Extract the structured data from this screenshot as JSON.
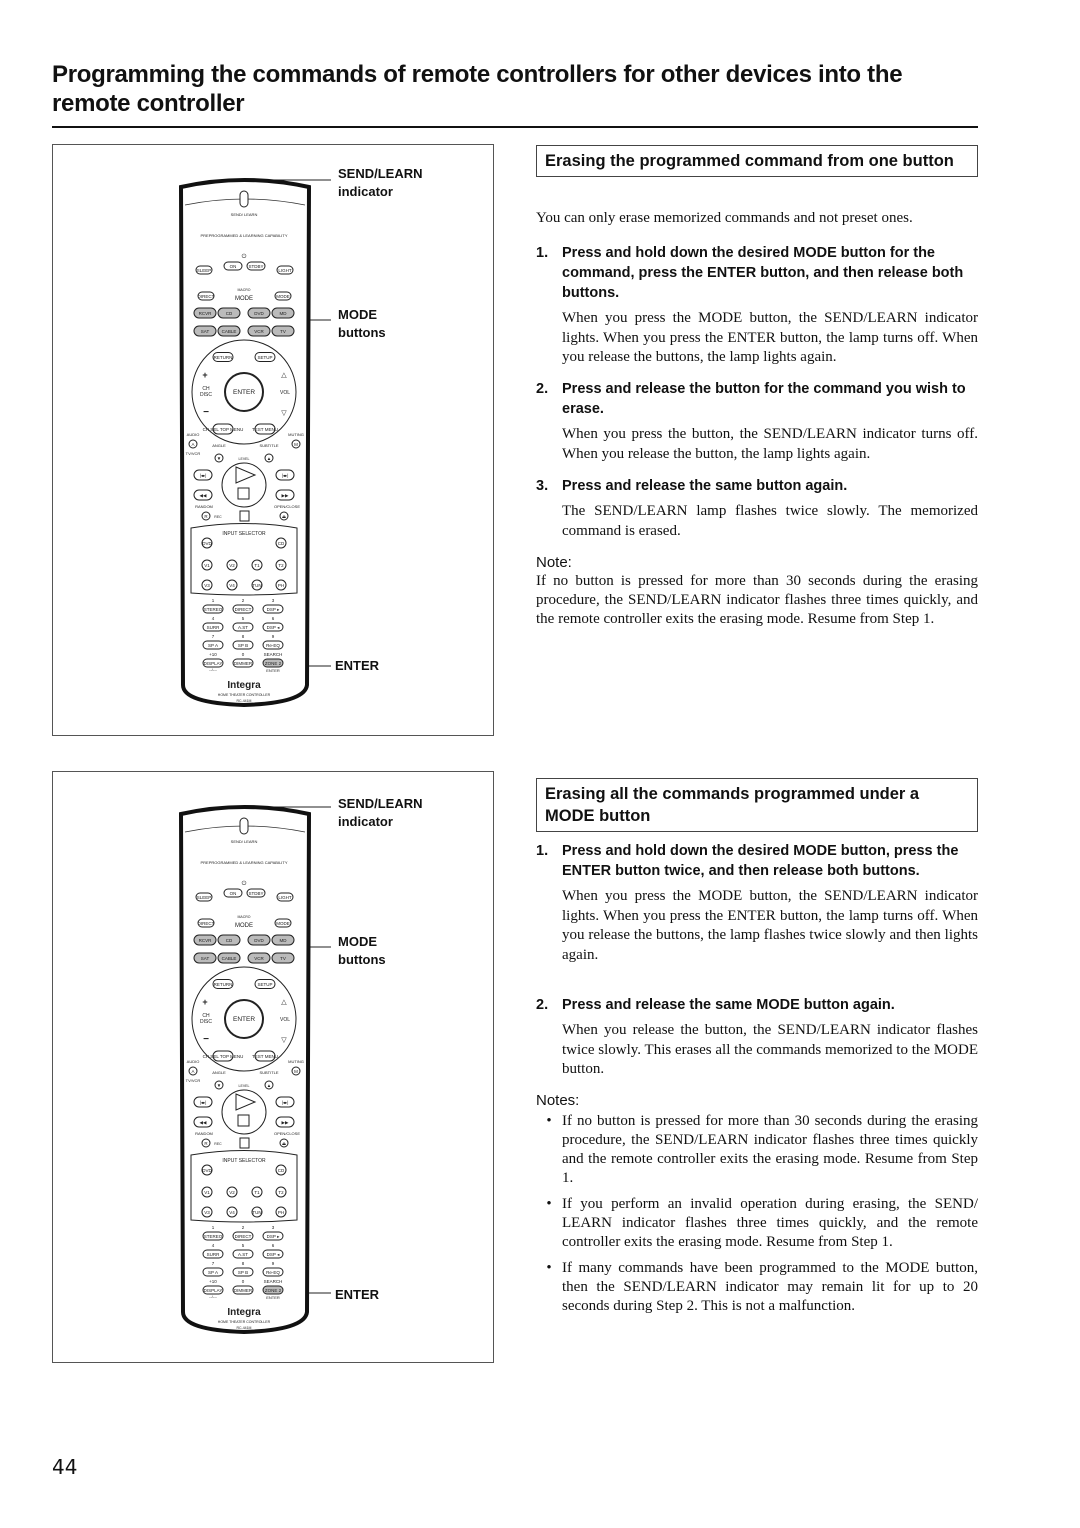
{
  "page": {
    "title": "Programming the commands of remote controllers for other devices into the remote controller",
    "page_number": "44"
  },
  "figures": [
    {
      "callouts": {
        "send_learn": "SEND/LEARN",
        "send_learn_sub": "indicator",
        "mode": "MODE",
        "mode_sub": "buttons",
        "enter": "ENTER"
      }
    },
    {
      "callouts": {
        "send_learn": "SEND/LEARN",
        "send_learn_sub": "indicator",
        "mode": "MODE",
        "mode_sub": "buttons",
        "enter": "ENTER"
      }
    }
  ],
  "remote": {
    "indicator_label": "SEND/ LEARN",
    "capability_text": "PREPROGRAMMED & LEARNING CAPABILITY",
    "power_icon": "power-icon",
    "top_buttons": [
      "SLEEP",
      "ON",
      "STDBY",
      "LIGHT"
    ],
    "macro_label": "MACRO",
    "direct_label": "DIRECT",
    "mode_btn_label": "MODE",
    "mode_group_label": "MODE",
    "mode_row1": [
      "RCVR",
      "CD",
      "DVD",
      "MD"
    ],
    "mode_row2": [
      "SAT",
      "CABLE",
      "VCR",
      "TV"
    ],
    "nav": {
      "return": "RETURN",
      "setup": "SETUP",
      "ch_disc": "CH DISC",
      "enter": "ENTER",
      "vol": "VOL",
      "top_menu": "CH SEL TOP MENU",
      "menu": "TEST MENU"
    },
    "audio_label": "AUDIO",
    "muting_label": "MUTING",
    "tvvcr_label": "TV/VCR",
    "angle_label": "ANGLE",
    "subtitle_label": "SUBTITLE",
    "level_label": "LEVEL",
    "random_label": "RANDOM",
    "rec_label": "REC",
    "open_close_label": "OPEN/CLOSE",
    "input_selector_label": "INPUT SELECTOR",
    "input_row1": [
      "DVD",
      "CD"
    ],
    "input_row2": [
      "V1",
      "V2",
      "T1",
      "T2"
    ],
    "input_row3": [
      "V3",
      "V4",
      "TUN",
      "PH"
    ],
    "keypad": [
      {
        "num": "1",
        "label": "STEREO"
      },
      {
        "num": "2",
        "label": "DIRECT"
      },
      {
        "num": "3",
        "label": "DSP ▸"
      },
      {
        "num": "4",
        "label": "SURR"
      },
      {
        "num": "5",
        "label": "A.ST"
      },
      {
        "num": "6",
        "label": "DSP ◂"
      },
      {
        "num": "7",
        "label": "SP A"
      },
      {
        "num": "8",
        "label": "SP B"
      },
      {
        "num": "9",
        "label": "Re-EQ"
      },
      {
        "num": "+10",
        "label": "DISPLAY"
      },
      {
        "num": "0",
        "label": "DIMMER"
      },
      {
        "num": "SEARCH",
        "label": "ZONE 2"
      }
    ],
    "dash_label": "--/---",
    "enter_small": "ENTER",
    "brand": "Integra",
    "model_line1": "HOME THEATER CONTROLLER",
    "model_line2": "RC-441M"
  },
  "section1": {
    "heading": "Erasing the programmed command from one button",
    "intro": "You can only erase memorized commands and not preset ones.",
    "steps": [
      {
        "num": "1.",
        "title": "Press and hold down the desired MODE button for the command, press the ENTER button, and then release both buttons.",
        "body": "When you press the MODE button, the SEND/LEARN indicator lights. When you press the ENTER button, the lamp turns off. When you release the buttons, the lamp lights again."
      },
      {
        "num": "2.",
        "title": "Press and release the button for the command you wish to erase.",
        "body": "When you press the button, the SEND/LEARN indicator turns off. When you release the button, the lamp lights again."
      },
      {
        "num": "3.",
        "title": "Press and release the same button again.",
        "body": "The SEND/LEARN lamp flashes twice slowly. The memorized command is erased."
      }
    ],
    "note_label": "Note:",
    "note": "If no button is pressed for more than 30 seconds during the erasing procedure, the SEND/LEARN indicator flashes three times quickly, and the remote controller exits the erasing mode. Resume from Step 1."
  },
  "section2": {
    "heading": "Erasing all the commands programmed under a MODE button",
    "steps": [
      {
        "num": "1.",
        "title": "Press and hold down the desired MODE button, press the ENTER button twice, and then release both buttons.",
        "body": "When you press the MODE button, the SEND/LEARN indicator lights. When you press the ENTER button, the lamp turns off. When you release the buttons, the lamp flashes twice slowly and then lights again."
      },
      {
        "num": "2.",
        "title": "Press and release the same MODE button again.",
        "body": "When you release the button, the SEND/LEARN indicator flashes twice slowly. This erases all the commands memorized to the MODE button."
      }
    ],
    "notes_label": "Notes:",
    "notes": [
      "If no button is pressed for more than 30 seconds during the erasing procedure, the SEND/LEARN indicator flashes three times quickly and the remote controller exits the erasing mode. Resume from Step 1.",
      "If you perform an invalid operation during erasing, the SEND/ LEARN indicator flashes three times quickly, and the remote controller exits the erasing mode. Resume from Step 1.",
      "If many commands have been programmed to the MODE button, then the SEND/LEARN indicator may remain lit for up to 20 seconds during Step 2. This is not a malfunction."
    ]
  }
}
